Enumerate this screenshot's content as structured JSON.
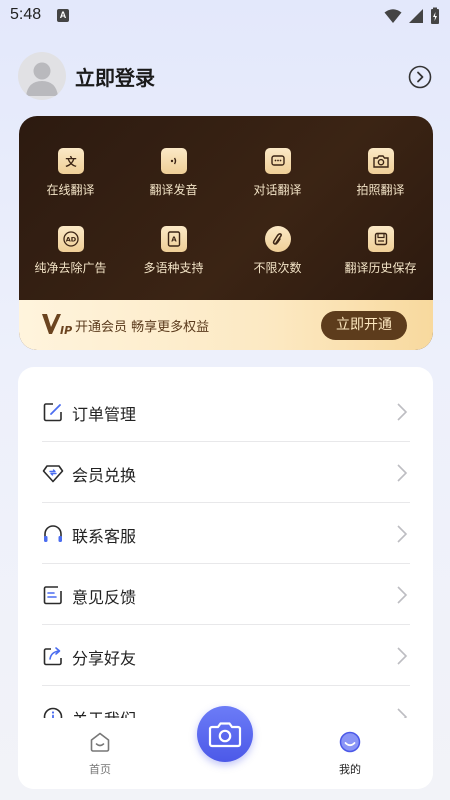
{
  "status_bar": {
    "time": "5:48",
    "notification_letter": "A"
  },
  "profile": {
    "login_label": "立即登录"
  },
  "vip_card": {
    "features": [
      {
        "label": "在线翻译",
        "icon": "translate-icon"
      },
      {
        "label": "翻译发音",
        "icon": "speaker-icon"
      },
      {
        "label": "对话翻译",
        "icon": "chat-icon"
      },
      {
        "label": "拍照翻译",
        "icon": "camera-icon"
      },
      {
        "label": "纯净去除广告",
        "icon": "ad-block-icon"
      },
      {
        "label": "多语种支持",
        "icon": "language-book-icon"
      },
      {
        "label": "不限次数",
        "icon": "infinite-icon"
      },
      {
        "label": "翻译历史保存",
        "icon": "history-save-icon"
      }
    ],
    "promo_text": "开通会员 畅享更多权益",
    "open_button": "立即开通"
  },
  "menu": {
    "items": [
      {
        "label": "订单管理",
        "icon": "edit-order-icon"
      },
      {
        "label": "会员兑换",
        "icon": "diamond-exchange-icon"
      },
      {
        "label": "联系客服",
        "icon": "headset-icon"
      },
      {
        "label": "意见反馈",
        "icon": "feedback-icon"
      },
      {
        "label": "分享好友",
        "icon": "share-icon"
      },
      {
        "label": "关于我们",
        "icon": "info-icon"
      }
    ]
  },
  "bottom_nav": {
    "home_label": "首页",
    "mine_label": "我的"
  },
  "colors": {
    "accent": "#4c59e8",
    "vip_dark": "#3b2414",
    "vip_gold": "#f0d09a"
  }
}
